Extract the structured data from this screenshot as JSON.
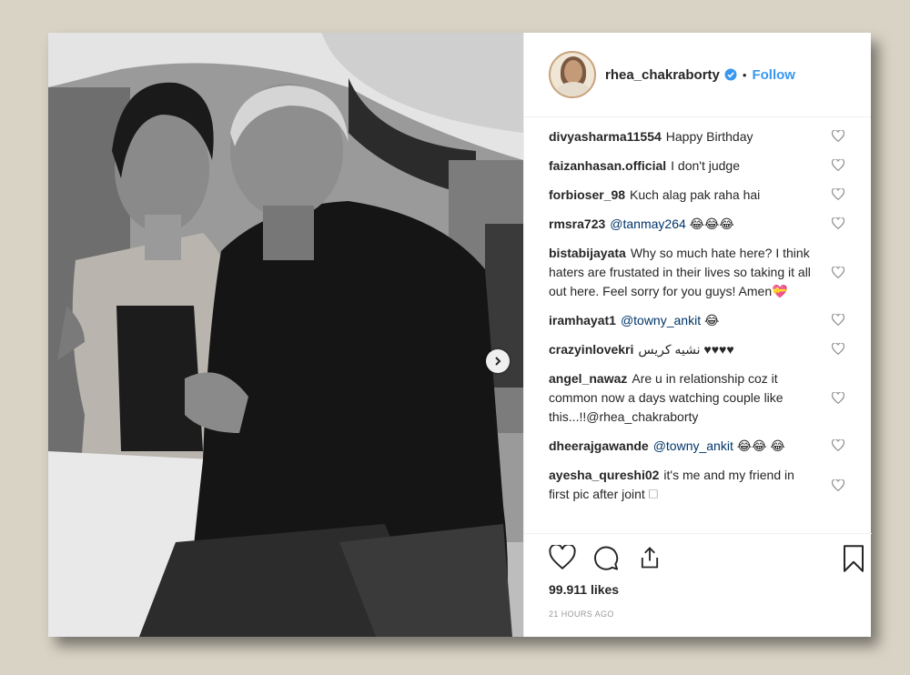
{
  "post": {
    "username": "rhea_chakraborty",
    "dot": "•",
    "follow_label": "Follow",
    "photo_alt": "Black and white photo of two people seated on a bed"
  },
  "comments": [
    {
      "user": "divyasharma11554",
      "text": "Happy Birthday",
      "mention": ""
    },
    {
      "user": "faizanhasan.official",
      "text": "I don't judge",
      "mention": ""
    },
    {
      "user": "forbioser_98",
      "text": "Kuch alag pak raha hai",
      "mention": ""
    },
    {
      "user": "rmsra723",
      "text": "😂😂😂",
      "mention": "@tanmay264"
    },
    {
      "user": "bistabijayata",
      "text": "Why so much hate here? I think haters are frustated in their lives so taking it all out here. Feel sorry for you guys! Amen💝",
      "mention": ""
    },
    {
      "user": "iramhayat1",
      "text": "😂",
      "mention": "@towny_ankit"
    },
    {
      "user": "crazyinlovekri",
      "text": "نشیه کریس ♥♥♥♥",
      "mention": ""
    },
    {
      "user": "angel_nawaz",
      "text": "Are u in relationship coz it common now a days watching couple like this...!!@rhea_chakraborty",
      "mention": ""
    },
    {
      "user": "dheerajgawande",
      "text": "😂😂 😂",
      "mention": "@towny_ankit"
    },
    {
      "user": "ayesha_qureshi02",
      "text": "it's me and my friend in first pic after joint 🗆",
      "mention": ""
    }
  ],
  "stats": {
    "likes": "99.911 likes",
    "time": "21 HOURS AGO"
  },
  "colors": {
    "accent": "#3897f0",
    "mention": "#003569",
    "text": "#262626",
    "background": "#d9d3c5"
  },
  "icons": [
    "verified-badge-icon",
    "heart-icon",
    "comment-icon",
    "share-icon",
    "bookmark-icon",
    "chevron-right-icon"
  ]
}
